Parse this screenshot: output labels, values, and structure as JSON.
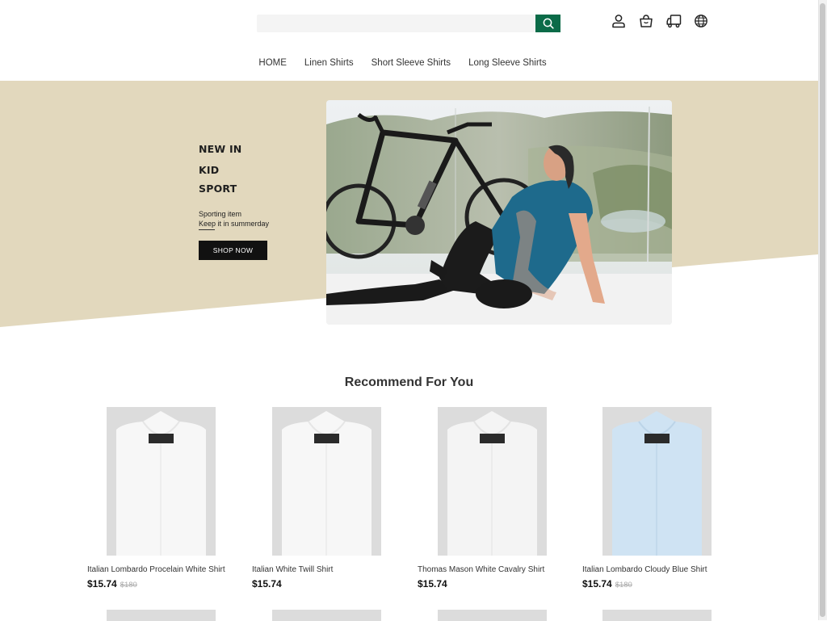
{
  "search": {
    "placeholder": "",
    "button_icon": "search-icon"
  },
  "header_icons": [
    "user-icon",
    "shopping-bag-icon",
    "truck-icon",
    "globe-icon"
  ],
  "nav": {
    "items": [
      "HOME",
      "Linen Shirts",
      "Short Sleeve Shirts",
      "Long Sleeve Shirts"
    ]
  },
  "hero": {
    "line1": "NEW IN",
    "line2": "KID",
    "line3": "SPORT",
    "sub1": "Sporting item",
    "sub2": "Keep it in summerday",
    "button": "SHOP NOW",
    "bg_color": "#e2d8bd"
  },
  "recommend": {
    "title": "Recommend For You",
    "products": [
      {
        "name": "Italian Lombardo Procelain White Shirt",
        "price": "$15.74",
        "old_price": "$180",
        "color": "#f7f7f7"
      },
      {
        "name": "Italian White Twill Shirt",
        "price": "$15.74",
        "old_price": "",
        "color": "#f7f7f7"
      },
      {
        "name": "Thomas Mason White Cavalry Shirt",
        "price": "$15.74",
        "old_price": "",
        "color": "#f4f4f4"
      },
      {
        "name": "Italian Lombardo Cloudy Blue Shirt",
        "price": "$15.74",
        "old_price": "$180",
        "color": "#cfe3f3"
      }
    ]
  },
  "colors": {
    "accent": "#0b6b48"
  }
}
